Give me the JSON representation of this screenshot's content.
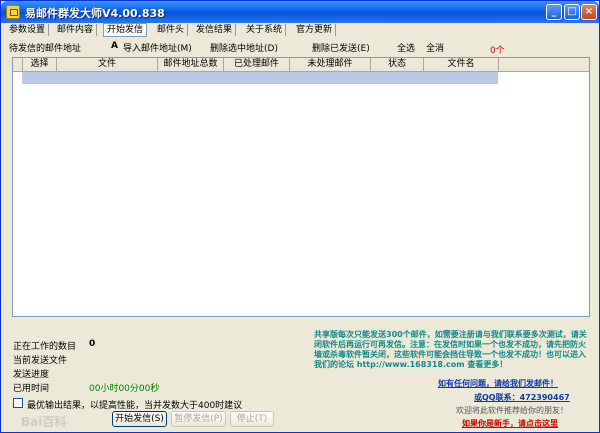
{
  "window": {
    "title": "易邮件群发大师V4.00.838"
  },
  "tabs": [
    "参数设置",
    "邮件内容",
    "开始发信",
    "邮件头",
    "发信结果",
    "关于系统",
    "官方更新"
  ],
  "toolbar": {
    "pending_label": "待发信的邮件地址",
    "import_label": "导入邮件地址(M)",
    "delete_label": "删除选中地址(D)",
    "delete_sent_label": "删除已发送(E)",
    "select_all": "全选",
    "check_all": "全消",
    "count": "0个"
  },
  "list": {
    "columns": [
      "选择",
      "文件",
      "邮件地址总数",
      "已处理邮件",
      "未处理邮件",
      "状态",
      "文件名"
    ]
  },
  "status": {
    "working_label": "正在工作的数目",
    "working_value": "0",
    "current_label": "当前发送文件",
    "progress_label": "发送进度",
    "time_label": "已用时间",
    "time_value": "00小时00分00秒"
  },
  "options": {
    "output_label": "最优输出结果，以提高性能，当并发数大于400时建议"
  },
  "buttons": {
    "start": "开始发信(S)",
    "pause": "暂停发信(P)",
    "stop": "停止(T)"
  },
  "info": {
    "text": "共享版每次只能发送300个邮件，如需要注册请与我们联系要多次测试，请关闭软件后再运行可再发信。注意：在发信时如果一个也发不成功，请先把防火墙或杀毒软件暂关闭，这些软件可能会挡住导致一个也发不成功！也可以进入我们的论坛 http://www.168318.com 查看更多！",
    "help_link": "如有任何问题，请给我们发邮件！",
    "qq_link": "或QQ联系：472390467",
    "recommend": "欢迎将此软件推荐给你的朋友！",
    "newbie_link": "如果你是新手，请点击这里"
  },
  "watermark": "Bai百科"
}
